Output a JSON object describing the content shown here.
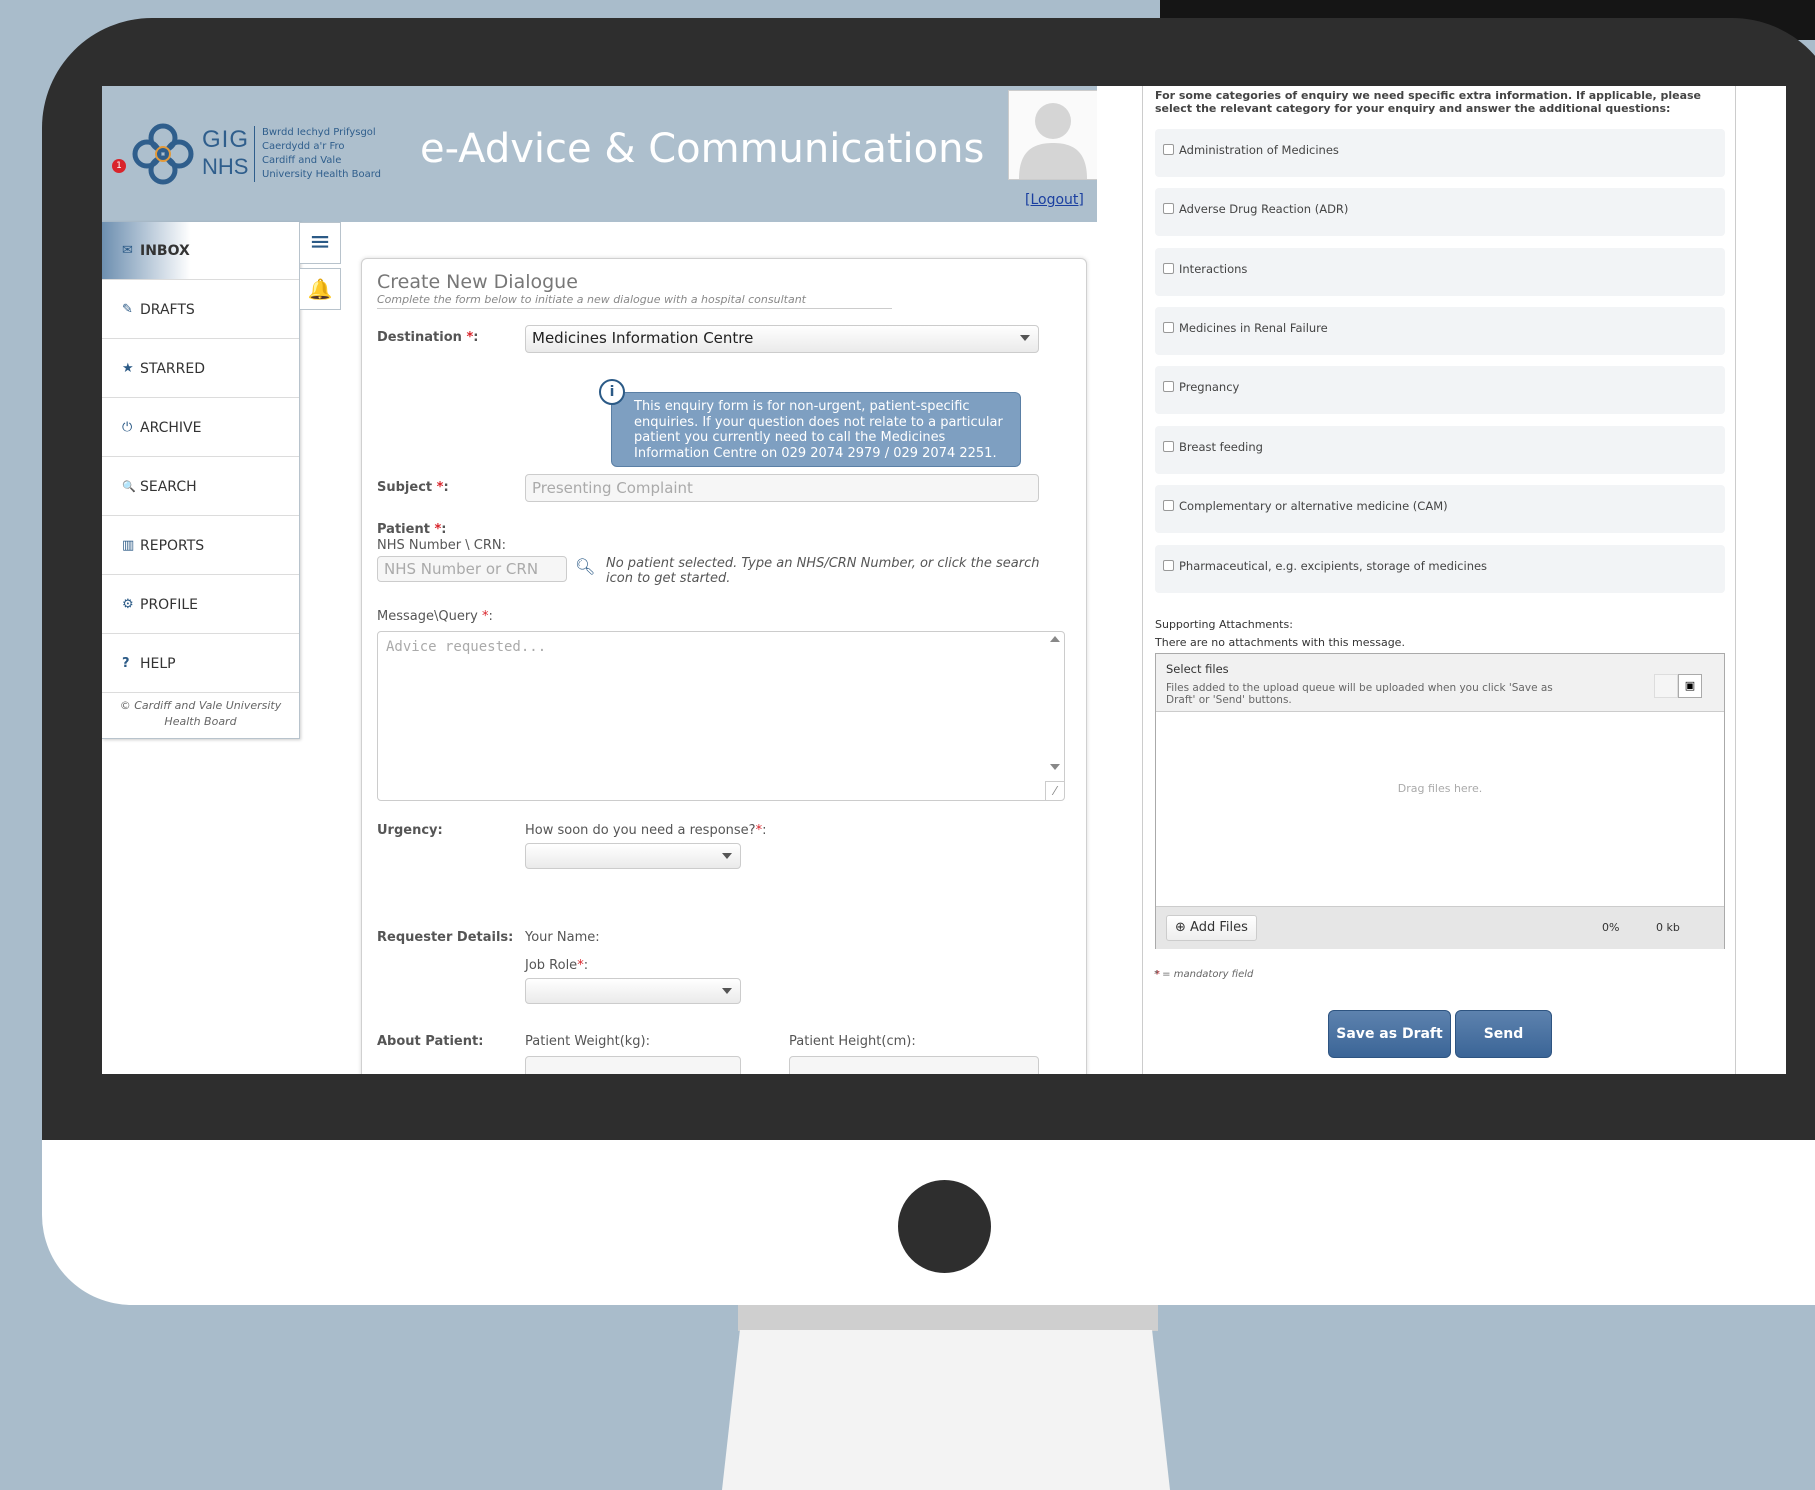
{
  "header": {
    "logo": {
      "gig": "GIG",
      "nhs": "NHS",
      "welsh_line1": "Bwrdd Iechyd Prifysgol",
      "welsh_line2": "Caerdydd a'r Fro",
      "english_line1": "Cardiff and Vale",
      "english_line2": "University Health Board"
    },
    "app_title": "e-Advice & Communications",
    "logout": "[Logout]"
  },
  "sidebar": {
    "items": [
      {
        "label": "INBOX",
        "icon": "envelope-icon",
        "glyph": "✉"
      },
      {
        "label": "DRAFTS",
        "icon": "pencil-icon",
        "glyph": "✎",
        "badge": "1"
      },
      {
        "label": "STARRED",
        "icon": "star-icon",
        "glyph": "★"
      },
      {
        "label": "ARCHIVE",
        "icon": "power-icon",
        "glyph": "⏻"
      },
      {
        "label": "SEARCH",
        "icon": "search-icon",
        "glyph": "🔍"
      },
      {
        "label": "REPORTS",
        "icon": "chart-icon",
        "glyph": "▥"
      },
      {
        "label": "PROFILE",
        "icon": "gear-icon",
        "glyph": "⚙"
      },
      {
        "label": "HELP",
        "icon": "question-icon",
        "glyph": "?"
      }
    ],
    "copyright": "© Cardiff and Vale University Health Board"
  },
  "form": {
    "title": "Create New Dialogue",
    "subtitle": "Complete the form below to initiate a new dialogue with a hospital consultant",
    "destination_label": "Destination ",
    "destination_value": "Medicines Information Centre",
    "info_text": "This enquiry form is for non-urgent, patient-specific enquiries. If your question does not relate to a particular patient you currently need to call the Medicines Information Centre on 029 2074 2979 / 029 2074 2251.",
    "subject_label": "Subject ",
    "subject_placeholder": "Presenting Complaint",
    "patient_label": "Patient ",
    "nhs_label": "NHS Number \\ CRN:",
    "nhs_placeholder": "NHS Number or CRN",
    "patient_hint": "No patient selected. Type an NHS/CRN Number, or click the search icon to get started.",
    "message_label": "Message\\Query ",
    "message_placeholder": "Advice requested...",
    "urgency_label": "Urgency:",
    "urgency_question": "How soon do you need a response?",
    "requester_label": "Requester Details:",
    "your_name_label": "Your Name:",
    "job_role_label": "Job Role",
    "about_patient_label": "About Patient:",
    "weight_label": "Patient Weight(kg):",
    "height_label": "Patient Height(cm):",
    "required_mark": "*",
    "colon": ":"
  },
  "right": {
    "intro": "For some categories of enquiry we need specific extra information. If applicable, please select the relevant category for your enquiry and answer the additional questions:",
    "categories": [
      "Administration of Medicines",
      "Adverse Drug Reaction (ADR)",
      "Interactions",
      "Medicines in Renal Failure",
      "Pregnancy",
      "Breast feeding",
      "Complementary or alternative medicine (CAM)",
      "Pharmaceutical, e.g. excipients, storage of medicines"
    ],
    "attachments_label": "Supporting Attachments:",
    "attachments_none": "There are no attachments with this message.",
    "uploader": {
      "title": "Select files",
      "description": "Files added to the upload queue will be uploaded when you click 'Save as Draft' or 'Send' buttons.",
      "drag_text": "Drag files here.",
      "add_files": "Add Files",
      "percent": "0%",
      "size": "0 kb"
    },
    "mandatory_note": "* = mandatory field",
    "save_draft": "Save as Draft",
    "send": "Send"
  },
  "colors": {
    "accent": "#3b6597",
    "required": "#d9242b",
    "header_bg": "#adbfcd",
    "info_bg": "#7e9fc1"
  }
}
